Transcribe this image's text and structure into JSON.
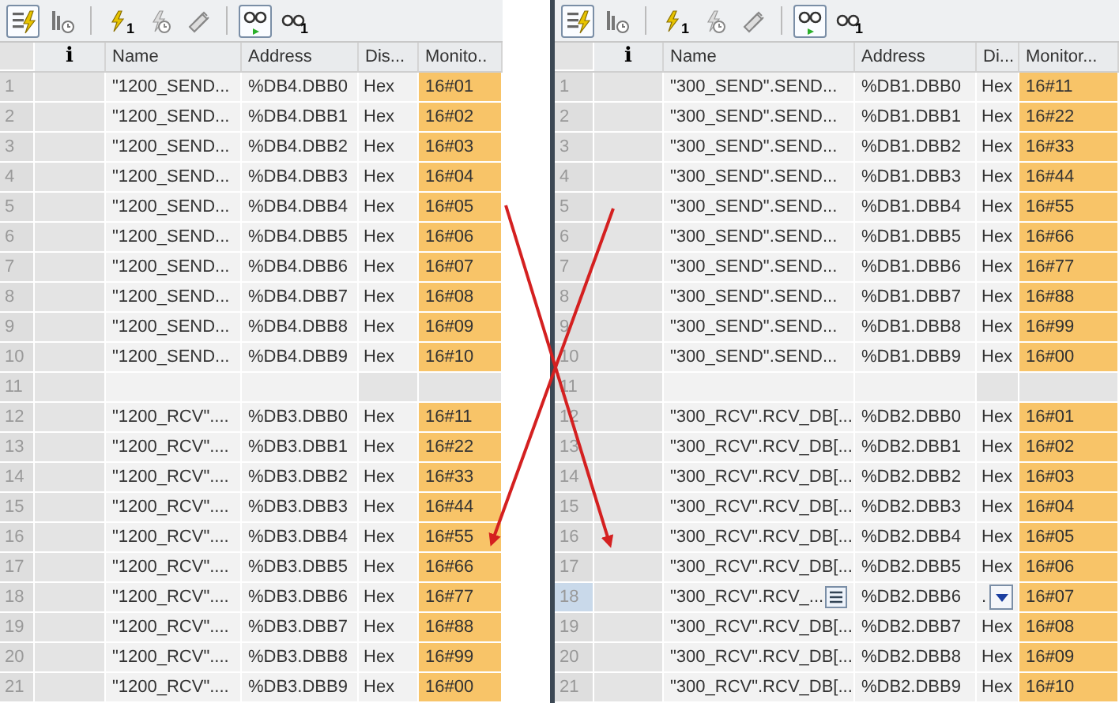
{
  "panels": [
    {
      "toolbar": [
        {
          "kind": "list-lightning",
          "pressed": true
        },
        {
          "kind": "list-clock",
          "pressed": false
        },
        {
          "kind": "lightning",
          "pressed": false,
          "badge": "1"
        },
        {
          "kind": "lightning-clock",
          "pressed": false
        },
        {
          "kind": "pencils",
          "pressed": false
        },
        {
          "kind": "glasses-play",
          "pressed": true
        },
        {
          "kind": "glasses",
          "pressed": false,
          "badge": "1"
        }
      ],
      "columns": [
        "i",
        "Name",
        "Address",
        "Dis...",
        "Monito.."
      ],
      "rows": [
        {
          "kind": "value",
          "number": "1",
          "name": "\"1200_SEND...",
          "address": "%DB4.DBB0",
          "display": "Hex",
          "monitor": "16#01",
          "selected": false
        },
        {
          "kind": "value",
          "number": "2",
          "name": "\"1200_SEND...",
          "address": "%DB4.DBB1",
          "display": "Hex",
          "monitor": "16#02",
          "selected": false
        },
        {
          "kind": "value",
          "number": "3",
          "name": "\"1200_SEND...",
          "address": "%DB4.DBB2",
          "display": "Hex",
          "monitor": "16#03",
          "selected": false
        },
        {
          "kind": "value",
          "number": "4",
          "name": "\"1200_SEND...",
          "address": "%DB4.DBB3",
          "display": "Hex",
          "monitor": "16#04",
          "selected": false
        },
        {
          "kind": "value",
          "number": "5",
          "name": "\"1200_SEND...",
          "address": "%DB4.DBB4",
          "display": "Hex",
          "monitor": "16#05",
          "selected": false
        },
        {
          "kind": "value",
          "number": "6",
          "name": "\"1200_SEND...",
          "address": "%DB4.DBB5",
          "display": "Hex",
          "monitor": "16#06",
          "selected": false
        },
        {
          "kind": "value",
          "number": "7",
          "name": "\"1200_SEND...",
          "address": "%DB4.DBB6",
          "display": "Hex",
          "monitor": "16#07",
          "selected": false
        },
        {
          "kind": "value",
          "number": "8",
          "name": "\"1200_SEND...",
          "address": "%DB4.DBB7",
          "display": "Hex",
          "monitor": "16#08",
          "selected": false
        },
        {
          "kind": "value",
          "number": "9",
          "name": "\"1200_SEND...",
          "address": "%DB4.DBB8",
          "display": "Hex",
          "monitor": "16#09",
          "selected": false
        },
        {
          "kind": "value",
          "number": "10",
          "name": "\"1200_SEND...",
          "address": "%DB4.DBB9",
          "display": "Hex",
          "monitor": "16#10",
          "selected": false
        },
        {
          "kind": "empty",
          "number": "11",
          "selected": false
        },
        {
          "kind": "value",
          "number": "12",
          "name": "\"1200_RCV\"....",
          "address": "%DB3.DBB0",
          "display": "Hex",
          "monitor": "16#11",
          "selected": false
        },
        {
          "kind": "value",
          "number": "13",
          "name": "\"1200_RCV\"....",
          "address": "%DB3.DBB1",
          "display": "Hex",
          "monitor": "16#22",
          "selected": false
        },
        {
          "kind": "value",
          "number": "14",
          "name": "\"1200_RCV\"....",
          "address": "%DB3.DBB2",
          "display": "Hex",
          "monitor": "16#33",
          "selected": false
        },
        {
          "kind": "value",
          "number": "15",
          "name": "\"1200_RCV\"....",
          "address": "%DB3.DBB3",
          "display": "Hex",
          "monitor": "16#44",
          "selected": false
        },
        {
          "kind": "value",
          "number": "16",
          "name": "\"1200_RCV\"....",
          "address": "%DB3.DBB4",
          "display": "Hex",
          "monitor": "16#55",
          "selected": false
        },
        {
          "kind": "value",
          "number": "17",
          "name": "\"1200_RCV\"....",
          "address": "%DB3.DBB5",
          "display": "Hex",
          "monitor": "16#66",
          "selected": false
        },
        {
          "kind": "value",
          "number": "18",
          "name": "\"1200_RCV\"....",
          "address": "%DB3.DBB6",
          "display": "Hex",
          "monitor": "16#77",
          "selected": false
        },
        {
          "kind": "value",
          "number": "19",
          "name": "\"1200_RCV\"....",
          "address": "%DB3.DBB7",
          "display": "Hex",
          "monitor": "16#88",
          "selected": false
        },
        {
          "kind": "value",
          "number": "20",
          "name": "\"1200_RCV\"....",
          "address": "%DB3.DBB8",
          "display": "Hex",
          "monitor": "16#99",
          "selected": false
        },
        {
          "kind": "value",
          "number": "21",
          "name": "\"1200_RCV\"....",
          "address": "%DB3.DBB9",
          "display": "Hex",
          "monitor": "16#00",
          "selected": false
        }
      ]
    },
    {
      "toolbar": [
        {
          "kind": "list-lightning",
          "pressed": true
        },
        {
          "kind": "list-clock",
          "pressed": false
        },
        {
          "kind": "lightning",
          "pressed": false,
          "badge": "1"
        },
        {
          "kind": "lightning-clock",
          "pressed": false
        },
        {
          "kind": "pencils",
          "pressed": false
        },
        {
          "kind": "glasses-play",
          "pressed": true
        },
        {
          "kind": "glasses",
          "pressed": false,
          "badge": "1"
        }
      ],
      "columns": [
        "i",
        "Name",
        "Address",
        "Di...",
        "Monitor..."
      ],
      "rows": [
        {
          "kind": "value",
          "number": "1",
          "name": "\"300_SEND\".SEND...",
          "address": "%DB1.DBB0",
          "display": "Hex",
          "monitor": "16#11",
          "selected": false
        },
        {
          "kind": "value",
          "number": "2",
          "name": "\"300_SEND\".SEND...",
          "address": "%DB1.DBB1",
          "display": "Hex",
          "monitor": "16#22",
          "selected": false
        },
        {
          "kind": "value",
          "number": "3",
          "name": "\"300_SEND\".SEND...",
          "address": "%DB1.DBB2",
          "display": "Hex",
          "monitor": "16#33",
          "selected": false
        },
        {
          "kind": "value",
          "number": "4",
          "name": "\"300_SEND\".SEND...",
          "address": "%DB1.DBB3",
          "display": "Hex",
          "monitor": "16#44",
          "selected": false
        },
        {
          "kind": "value",
          "number": "5",
          "name": "\"300_SEND\".SEND...",
          "address": "%DB1.DBB4",
          "display": "Hex",
          "monitor": "16#55",
          "selected": false
        },
        {
          "kind": "value",
          "number": "6",
          "name": "\"300_SEND\".SEND...",
          "address": "%DB1.DBB5",
          "display": "Hex",
          "monitor": "16#66",
          "selected": false
        },
        {
          "kind": "value",
          "number": "7",
          "name": "\"300_SEND\".SEND...",
          "address": "%DB1.DBB6",
          "display": "Hex",
          "monitor": "16#77",
          "selected": false
        },
        {
          "kind": "value",
          "number": "8",
          "name": "\"300_SEND\".SEND...",
          "address": "%DB1.DBB7",
          "display": "Hex",
          "monitor": "16#88",
          "selected": false
        },
        {
          "kind": "value",
          "number": "9",
          "name": "\"300_SEND\".SEND...",
          "address": "%DB1.DBB8",
          "display": "Hex",
          "monitor": "16#99",
          "selected": false
        },
        {
          "kind": "value",
          "number": "10",
          "name": "\"300_SEND\".SEND...",
          "address": "%DB1.DBB9",
          "display": "Hex",
          "monitor": "16#00",
          "selected": false
        },
        {
          "kind": "empty",
          "number": "11",
          "selected": false
        },
        {
          "kind": "value",
          "number": "12",
          "name": "\"300_RCV\".RCV_DB[...",
          "address": "%DB2.DBB0",
          "display": "Hex",
          "monitor": "16#01",
          "selected": false
        },
        {
          "kind": "value",
          "number": "13",
          "name": "\"300_RCV\".RCV_DB[...",
          "address": "%DB2.DBB1",
          "display": "Hex",
          "monitor": "16#02",
          "selected": false
        },
        {
          "kind": "value",
          "number": "14",
          "name": "\"300_RCV\".RCV_DB[...",
          "address": "%DB2.DBB2",
          "display": "Hex",
          "monitor": "16#03",
          "selected": false
        },
        {
          "kind": "value",
          "number": "15",
          "name": "\"300_RCV\".RCV_DB[...",
          "address": "%DB2.DBB3",
          "display": "Hex",
          "monitor": "16#04",
          "selected": false
        },
        {
          "kind": "value",
          "number": "16",
          "name": "\"300_RCV\".RCV_DB[...",
          "address": "%DB2.DBB4",
          "display": "Hex",
          "monitor": "16#05",
          "selected": false
        },
        {
          "kind": "value",
          "number": "17",
          "name": "\"300_RCV\".RCV_DB[...",
          "address": "%DB2.DBB5",
          "display": "Hex",
          "monitor": "16#06",
          "selected": false
        },
        {
          "kind": "value",
          "number": "18",
          "name": "\"300_RCV\".RCV_...",
          "address": "%DB2.DBB6",
          "display": ".",
          "monitor": "16#07",
          "selected": true
        },
        {
          "kind": "value",
          "number": "19",
          "name": "\"300_RCV\".RCV_DB[...",
          "address": "%DB2.DBB7",
          "display": "Hex",
          "monitor": "16#08",
          "selected": false
        },
        {
          "kind": "value",
          "number": "20",
          "name": "\"300_RCV\".RCV_DB[...",
          "address": "%DB2.DBB8",
          "display": "Hex",
          "monitor": "16#09",
          "selected": false
        },
        {
          "kind": "value",
          "number": "21",
          "name": "\"300_RCV\".RCV_DB[...",
          "address": "%DB2.DBB9",
          "display": "Hex",
          "monitor": "16#10",
          "selected": false
        }
      ]
    }
  ]
}
